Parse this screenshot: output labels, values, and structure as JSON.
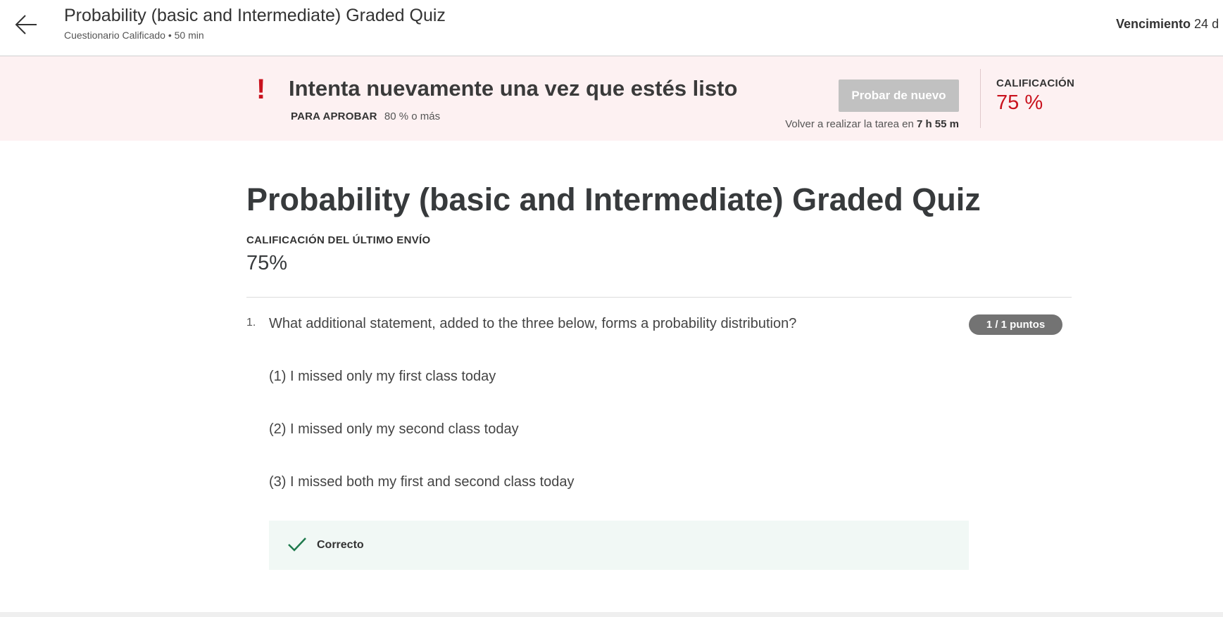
{
  "header": {
    "title": "Probability (basic and Intermediate) Graded Quiz",
    "subtitle": "Cuestionario Calificado • 50 min",
    "due_label": "Vencimiento",
    "due_value": "24 d"
  },
  "banner": {
    "heading": "Intenta nuevamente una vez que estés listo",
    "pass_label": "PARA APROBAR",
    "pass_value": "80 % o más",
    "retry_button": "Probar de nuevo",
    "retake_text": "Volver a realizar la tarea en",
    "retake_time": "7 h 55 m",
    "grade_label": "CALIFICACIÓN",
    "grade_value": "75 %"
  },
  "main": {
    "quiz_title": "Probability (basic and Intermediate) Graded Quiz",
    "last_submission_label": "CALIFICACIÓN DEL ÚLTIMO ENVÍO",
    "last_submission_value": "75%"
  },
  "question": {
    "number": "1.",
    "text": "What additional statement, added to the three below, forms a probability distribution?",
    "points": "1 / 1 puntos",
    "statements": [
      "(1) I missed only my first class today",
      "(2) I missed only my second class today",
      "(3) I missed both my first and second class today"
    ],
    "feedback": "Correcto"
  },
  "colors": {
    "accent_red": "#c9121e",
    "banner_bg": "#fdf1f2",
    "correct_green": "#1f7a4d",
    "feedback_bg": "#f1f8f5"
  },
  "icons": {
    "back": "arrow-left-icon",
    "alert": "exclamation-icon",
    "correct": "checkmark-icon"
  }
}
